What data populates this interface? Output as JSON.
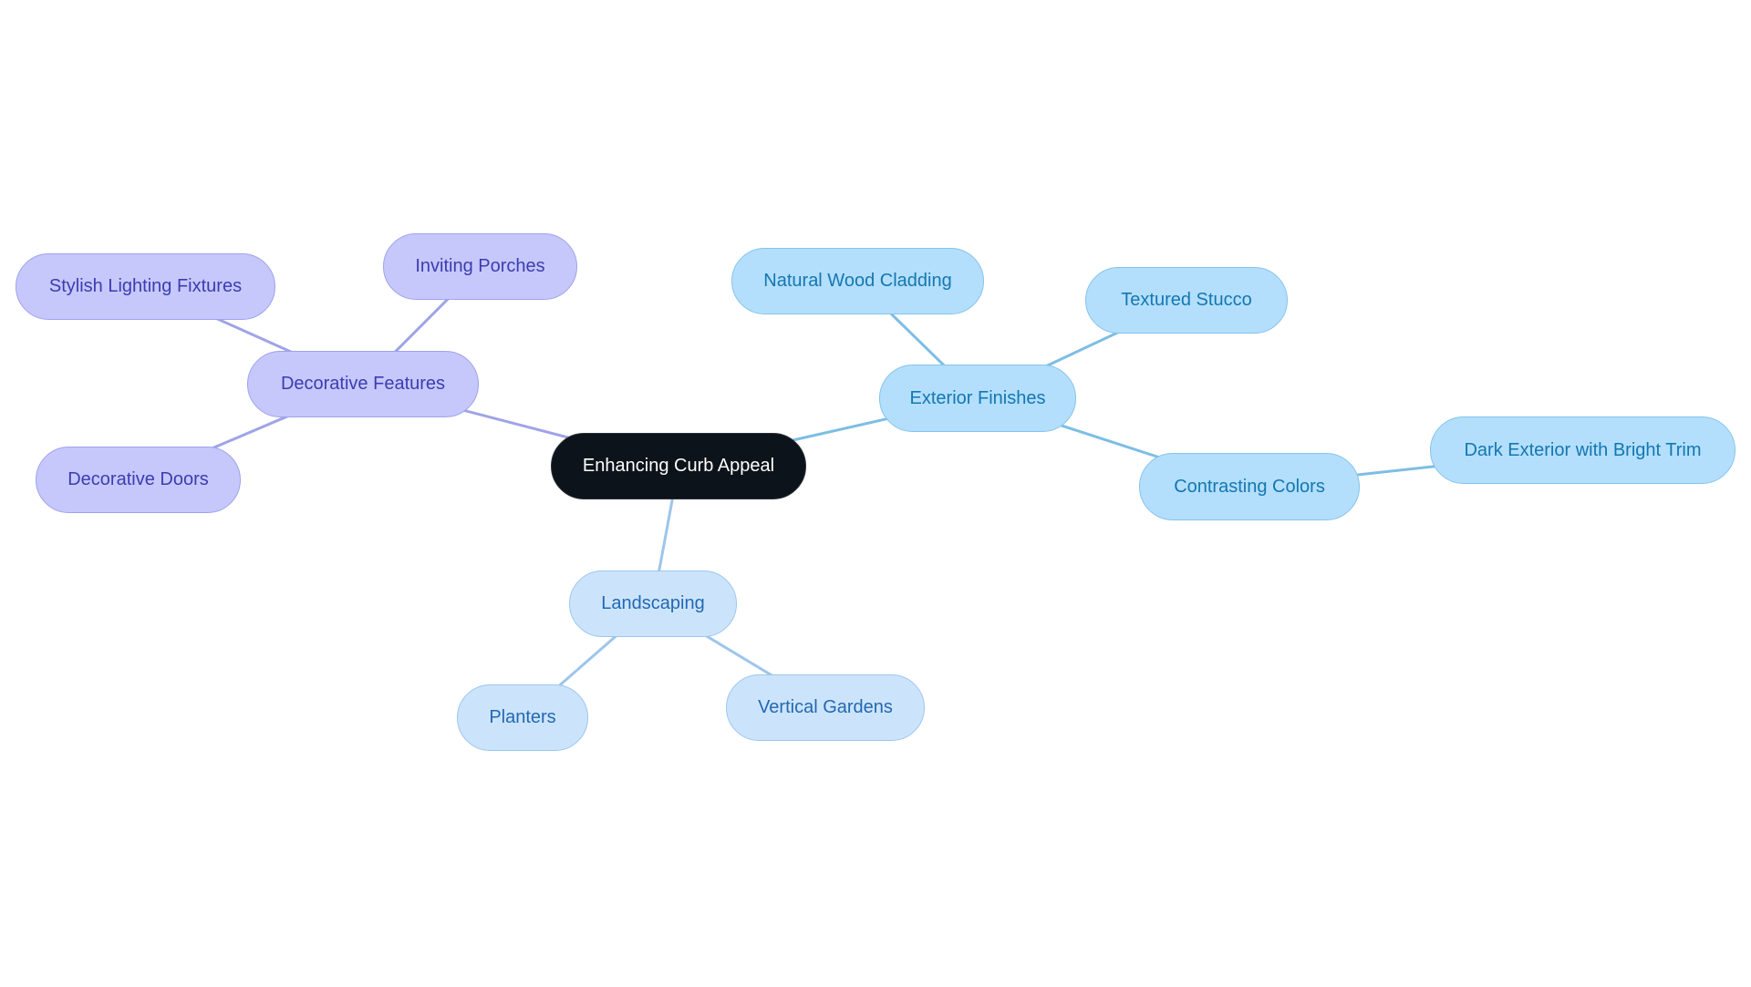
{
  "diagram": {
    "type": "mindmap",
    "root": {
      "id": "root",
      "label": "Enhancing Curb Appeal"
    },
    "branches": [
      {
        "id": "decorative-features",
        "label": "Decorative Features",
        "theme": "purple",
        "children": [
          {
            "id": "stylish-lighting-fixtures",
            "label": "Stylish Lighting Fixtures"
          },
          {
            "id": "inviting-porches",
            "label": "Inviting Porches"
          },
          {
            "id": "decorative-doors",
            "label": "Decorative Doors"
          }
        ]
      },
      {
        "id": "exterior-finishes",
        "label": "Exterior Finishes",
        "theme": "blue",
        "children": [
          {
            "id": "natural-wood-cladding",
            "label": "Natural Wood Cladding"
          },
          {
            "id": "textured-stucco",
            "label": "Textured Stucco"
          },
          {
            "id": "contrasting-colors",
            "label": "Contrasting Colors",
            "children": [
              {
                "id": "dark-exterior-with-bright-trim",
                "label": "Dark Exterior with Bright Trim"
              }
            ]
          }
        ]
      },
      {
        "id": "landscaping",
        "label": "Landscaping",
        "theme": "lightblue",
        "children": [
          {
            "id": "planters",
            "label": "Planters"
          },
          {
            "id": "vertical-gardens",
            "label": "Vertical Gardens"
          }
        ]
      }
    ],
    "colors": {
      "root_fill": "#0d131a",
      "root_text": "#ffffff",
      "purple_fill": "#c6c8fc",
      "purple_text": "#3b3db0",
      "purple_edge": "#a0a3e6",
      "blue_fill": "#b3dffd",
      "blue_text": "#1477b0",
      "blue_edge": "#7dbee5",
      "lightblue_fill": "#cce4fb",
      "lightblue_text": "#2268b3",
      "lightblue_edge": "#9ec5ea"
    }
  }
}
